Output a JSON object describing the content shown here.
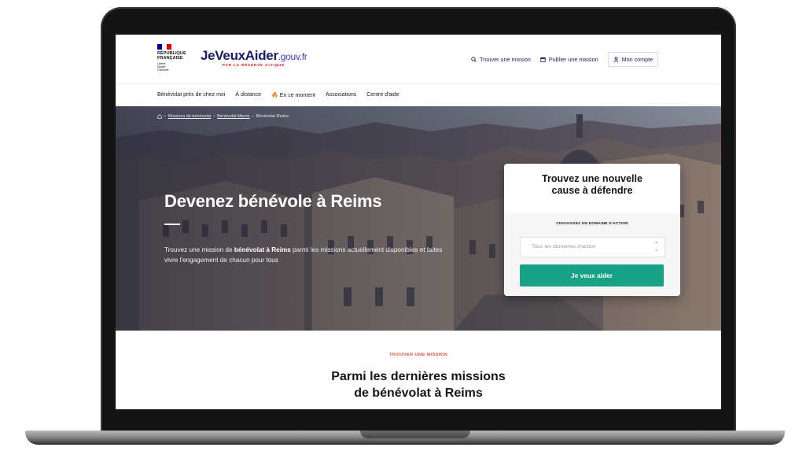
{
  "header": {
    "gov_logo": {
      "lines": [
        "RÉPUBLIQUE",
        "FRANÇAISE"
      ],
      "motto": [
        "Liberté",
        "Égalité",
        "Fraternité"
      ]
    },
    "brand": {
      "name": "JeVeuxAider",
      "domain": ".gouv.fr",
      "tagline": "PAR LA RÉSERVE CIVIQUE"
    },
    "links": [
      {
        "label": "Trouver une mission",
        "icon": "search-icon"
      },
      {
        "label": "Publier une mission",
        "icon": "calendar-icon"
      },
      {
        "label": "Mon compte",
        "icon": "user-icon"
      }
    ]
  },
  "nav": {
    "items": [
      "Bénévolat près de chez moi",
      "À distance",
      "En ce moment",
      "Associations",
      "Centre d'aide"
    ],
    "highlight_icon": "fire-icon"
  },
  "breadcrumb": {
    "home_icon": "home-icon",
    "items": [
      "Missions de bénévolat",
      "Bénévolat Marne",
      "Bénévolat Reims"
    ]
  },
  "hero": {
    "title": "Devenez bénévole à Reims",
    "text_before": "Trouvez une mission de ",
    "text_bold": "bénévolat à Reims",
    "text_after": " parmi les missions actuellement disponibles et faites vivre l'engagement de chacun pour tous"
  },
  "search_card": {
    "title_line1": "Trouvez une nouvelle",
    "title_line2": "cause à défendre",
    "label": "CHOISISSEZ UN DOMAINE D'ACTION",
    "select_placeholder": "Tous les domaines d'action",
    "button_label": "Je veux aider"
  },
  "missions_section": {
    "kicker": "TROUVER UNE MISSION",
    "title_line1": "Parmi les dernières missions",
    "title_line2": "de bénévolat à Reims"
  },
  "colors": {
    "brand_blue": "#1a1a6e",
    "accent_green": "#17a185",
    "kicker_red": "#e75a4a",
    "flag_blue": "#000091",
    "flag_red": "#e1000f"
  }
}
